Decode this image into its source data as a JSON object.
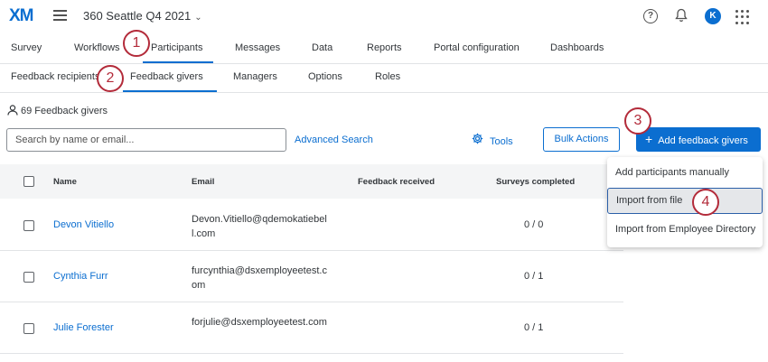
{
  "header": {
    "logo": "XM",
    "project": "360 Seattle Q4 2021",
    "avatar_initial": "K"
  },
  "nav_primary": [
    "Survey",
    "Workflows",
    "Participants",
    "Messages",
    "Data",
    "Reports",
    "Portal configuration",
    "Dashboards"
  ],
  "nav_secondary": [
    "Feedback recipients",
    "Feedback givers",
    "Managers",
    "Options",
    "Roles"
  ],
  "steps": [
    "1",
    "2",
    "3",
    "4"
  ],
  "summary": {
    "count_text": "69 Feedback givers"
  },
  "toolbar": {
    "search_placeholder": "Search by name or email...",
    "advanced_search": "Advanced Search",
    "tools": "Tools",
    "bulk_actions": "Bulk Actions",
    "add_feedback_givers": "Add feedback givers"
  },
  "table": {
    "headers": [
      "Name",
      "Email",
      "Feedback received",
      "Surveys completed"
    ],
    "rows": [
      {
        "name": "Devon Vitiello",
        "email": "Devon.Vitiello@qdemokatiebell.com",
        "surveys": "0 / 0"
      },
      {
        "name": "Cynthia Furr",
        "email": "furcynthia@dsxemployeetest.com",
        "surveys": "0 / 1"
      },
      {
        "name": "Julie Forester",
        "email": "forjulie@dsxemployeetest.com",
        "surveys": "0 / 1"
      }
    ]
  },
  "dropdown": [
    "Add participants manually",
    "Import from file",
    "Import from Employee Directory"
  ],
  "colors": {
    "accent": "#0b6ed0",
    "annotation": "#b32b3a"
  }
}
